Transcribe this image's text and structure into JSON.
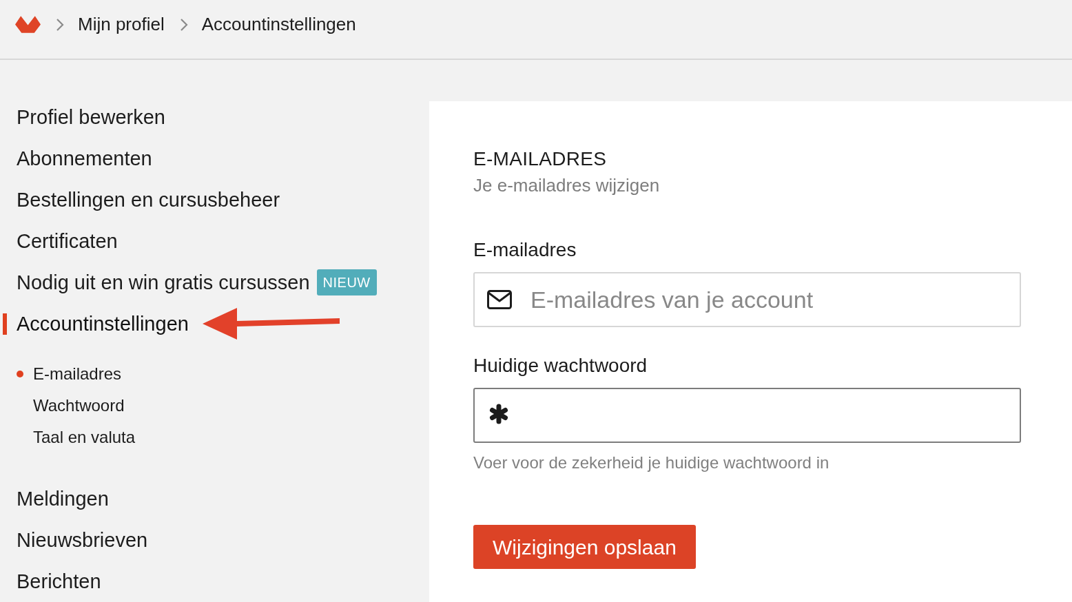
{
  "breadcrumb": {
    "items": [
      {
        "label": "Mijn profiel"
      },
      {
        "label": "Accountinstellingen"
      }
    ]
  },
  "sidebar": {
    "items": [
      {
        "label": "Profiel bewerken",
        "selected": false,
        "arrow": false
      },
      {
        "label": "Abonnementen",
        "selected": false,
        "arrow": false
      },
      {
        "label": "Bestellingen en cursusbeheer",
        "selected": false,
        "arrow": false
      },
      {
        "label": "Certificaten",
        "selected": false,
        "arrow": false
      },
      {
        "label": "Nodig uit en win gratis cursussen",
        "selected": false,
        "arrow": false,
        "badge": "NIEUW"
      },
      {
        "label": "Accountinstellingen",
        "selected": true,
        "arrow": true,
        "children": [
          {
            "label": "E-mailadres",
            "selected": true
          },
          {
            "label": "Wachtwoord",
            "selected": false
          },
          {
            "label": "Taal en valuta",
            "selected": false
          }
        ]
      },
      {
        "label": "Meldingen",
        "selected": false,
        "arrow": false
      },
      {
        "label": "Nieuwsbrieven",
        "selected": false,
        "arrow": false
      },
      {
        "label": "Berichten",
        "selected": false,
        "arrow": false
      }
    ]
  },
  "section": {
    "title": "E-MAILADRES",
    "subtitle": "Je e-mailadres wijzigen"
  },
  "fields": [
    {
      "kind": "email",
      "label": "E-mailadres",
      "placeholder": "E-mailadres van je account",
      "focused": false
    },
    {
      "kind": "password",
      "label": "Huidige wachtwoord",
      "focused": true,
      "hint": "Voer voor de zekerheid je huidige wachtwoord in"
    }
  ],
  "save_button": {
    "label": "Wijzigingen opslaan"
  }
}
